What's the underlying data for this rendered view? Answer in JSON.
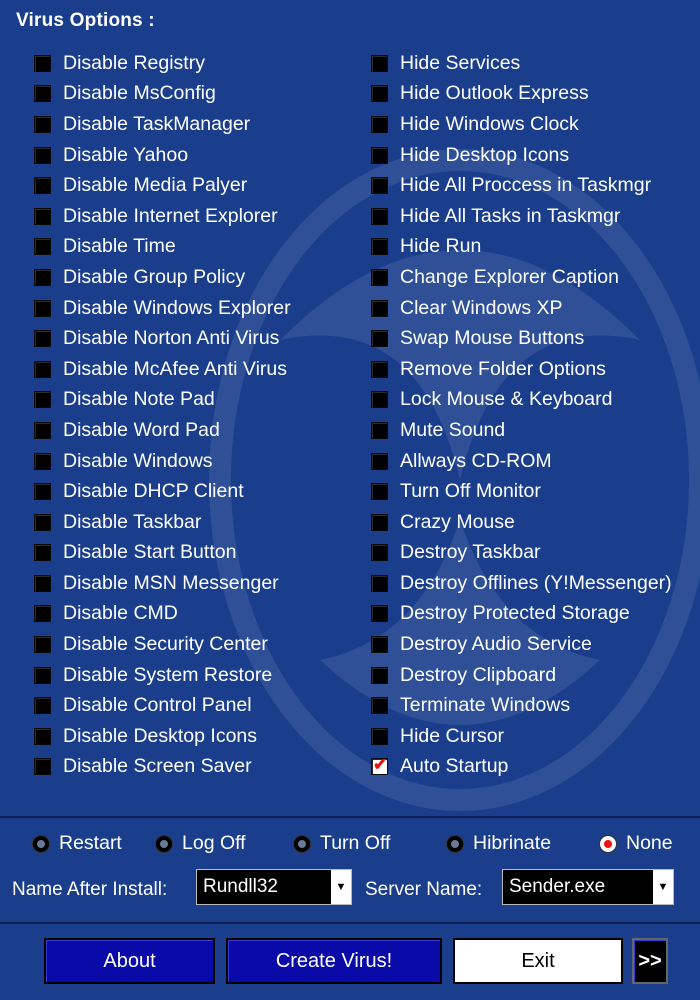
{
  "title": "Virus Options :",
  "left_options": [
    {
      "label": "Disable Registry",
      "checked": false
    },
    {
      "label": "Disable MsConfig",
      "checked": false
    },
    {
      "label": "Disable TaskManager",
      "checked": false
    },
    {
      "label": "Disable Yahoo",
      "checked": false
    },
    {
      "label": "Disable Media Palyer",
      "checked": false
    },
    {
      "label": "Disable Internet Explorer",
      "checked": false
    },
    {
      "label": "Disable Time",
      "checked": false
    },
    {
      "label": "Disable Group Policy",
      "checked": false
    },
    {
      "label": "Disable Windows Explorer",
      "checked": false
    },
    {
      "label": "Disable Norton Anti Virus",
      "checked": false
    },
    {
      "label": "Disable McAfee Anti Virus",
      "checked": false
    },
    {
      "label": "Disable Note Pad",
      "checked": false
    },
    {
      "label": "Disable Word Pad",
      "checked": false
    },
    {
      "label": "Disable Windows",
      "checked": false
    },
    {
      "label": "Disable DHCP Client",
      "checked": false
    },
    {
      "label": "Disable Taskbar",
      "checked": false
    },
    {
      "label": "Disable Start Button",
      "checked": false
    },
    {
      "label": "Disable MSN Messenger",
      "checked": false
    },
    {
      "label": "Disable CMD",
      "checked": false
    },
    {
      "label": "Disable Security Center",
      "checked": false
    },
    {
      "label": "Disable System Restore",
      "checked": false
    },
    {
      "label": "Disable Control Panel",
      "checked": false
    },
    {
      "label": "Disable Desktop Icons",
      "checked": false
    },
    {
      "label": "Disable Screen Saver",
      "checked": false
    }
  ],
  "right_options": [
    {
      "label": "Hide Services",
      "checked": false
    },
    {
      "label": "Hide Outlook Express",
      "checked": false
    },
    {
      "label": "Hide Windows Clock",
      "checked": false
    },
    {
      "label": "Hide Desktop Icons",
      "checked": false
    },
    {
      "label": "Hide All Proccess in Taskmgr",
      "checked": false
    },
    {
      "label": "Hide All Tasks in Taskmgr",
      "checked": false
    },
    {
      "label": "Hide Run",
      "checked": false
    },
    {
      "label": "Change Explorer Caption",
      "checked": false
    },
    {
      "label": "Clear Windows XP",
      "checked": false
    },
    {
      "label": "Swap Mouse Buttons",
      "checked": false
    },
    {
      "label": "Remove Folder Options",
      "checked": false
    },
    {
      "label": "Lock Mouse & Keyboard",
      "checked": false
    },
    {
      "label": "Mute Sound",
      "checked": false
    },
    {
      "label": "Allways CD-ROM",
      "checked": false
    },
    {
      "label": "Turn Off Monitor",
      "checked": false
    },
    {
      "label": "Crazy Mouse",
      "checked": false
    },
    {
      "label": "Destroy Taskbar",
      "checked": false
    },
    {
      "label": "Destroy Offlines (Y!Messenger)",
      "checked": false
    },
    {
      "label": "Destroy Protected Storage",
      "checked": false
    },
    {
      "label": "Destroy Audio Service",
      "checked": false
    },
    {
      "label": "Destroy Clipboard",
      "checked": false
    },
    {
      "label": "Terminate Windows",
      "checked": false
    },
    {
      "label": "Hide Cursor",
      "checked": false
    },
    {
      "label": "Auto Startup",
      "checked": true
    }
  ],
  "radios": [
    {
      "label": "Restart",
      "selected": false
    },
    {
      "label": "Log Off",
      "selected": false
    },
    {
      "label": "Turn Off",
      "selected": false
    },
    {
      "label": "Hibrinate",
      "selected": false
    },
    {
      "label": "None",
      "selected": true
    }
  ],
  "install": {
    "label": "Name After Install:",
    "value": "Rundll32"
  },
  "server": {
    "label": "Server Name:",
    "value": "Sender.exe"
  },
  "buttons": {
    "about": "About",
    "create": "Create Virus!",
    "exit": "Exit",
    "more": ">>"
  },
  "colors": {
    "background": "#1a3d8c",
    "button_blue": "#0a0aa8",
    "check_red": "#e11111"
  }
}
